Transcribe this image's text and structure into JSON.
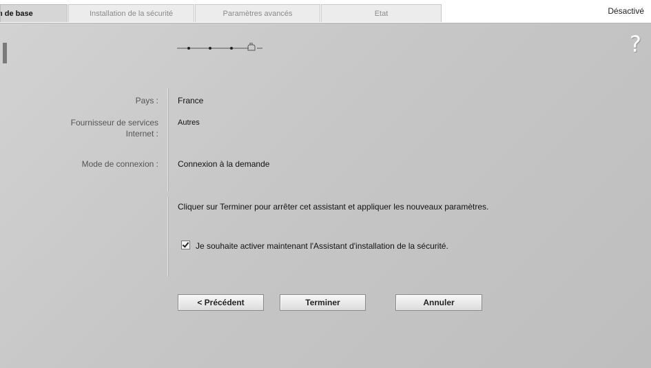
{
  "tabs": [
    {
      "label": "n de base",
      "active": true
    },
    {
      "label": "Installation de la sécurité",
      "active": false
    },
    {
      "label": "Paramètres avancés",
      "active": false
    },
    {
      "label": "Etat",
      "active": false
    }
  ],
  "status": "Désactivé",
  "help_symbol": "?",
  "wizard": {
    "total_steps": 4,
    "current_step": 4
  },
  "form": {
    "pays_label": "Pays :",
    "pays_value": "France",
    "fai_label_line1": "Fournisseur de services",
    "fai_label_line2": "Internet :",
    "fai_value": "Autres",
    "mode_label": "Mode de connexion :",
    "mode_value": "Connexion à la demande"
  },
  "info": "Cliquer sur Terminer pour arrêter cet assistant et appliquer les nouveaux paramètres.",
  "checkbox": {
    "checked": true,
    "label": "Je souhaite activer maintenant l'Assistant d'installation de la sécurité."
  },
  "buttons": {
    "previous": "< Précédent",
    "finish": "Terminer",
    "cancel": "Annuler"
  },
  "colors": {
    "panel": "#c8c8c8",
    "tab_inactive": "#ececec",
    "tab_active": "#d6d6d6"
  }
}
